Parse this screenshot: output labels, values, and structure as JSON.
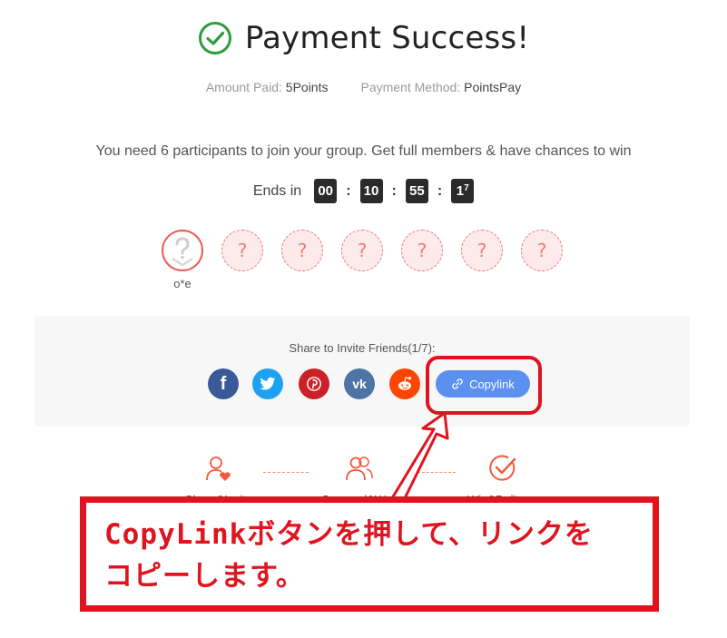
{
  "header": {
    "title": "Payment Success!",
    "icon": "check-circle-icon",
    "accent": "#2e9c3a"
  },
  "payment": {
    "amount_label": "Amount Paid:",
    "amount_value": "5Points",
    "method_label": "Payment Method:",
    "method_value": "PointsPay"
  },
  "group": {
    "message": "You need 6 participants to join your group. Get full members & have chances to win",
    "ends_label": "Ends in",
    "timer": {
      "hours": "00",
      "minutes": "10",
      "seconds": "55",
      "fraction_main": "1",
      "fraction_sup": "7"
    },
    "owner_name": "o*e",
    "empty_slot_symbol": "?"
  },
  "share": {
    "title": "Share to Invite Friends(1/7):",
    "networks": [
      "facebook-icon",
      "twitter-icon",
      "pinterest-icon",
      "vk-icon",
      "reddit-icon"
    ],
    "colors": {
      "facebook": "#3b5998",
      "twitter": "#1da1f2",
      "pinterest": "#cb2027",
      "vk": "#4c75a3",
      "reddit": "#ff4500",
      "copylink": "#5b8ff0"
    },
    "copylink_label": "Copylink"
  },
  "steps": [
    {
      "label": "Share&Invite",
      "icon": "share-invite-icon"
    },
    {
      "label": "Grouped&Wait",
      "icon": "group-wait-icon"
    },
    {
      "label": "Win&Delivery",
      "icon": "win-delivery-icon"
    }
  ],
  "annotation": {
    "line1": "CopyLinkボタンを押して、リンクを",
    "line2": "コピーします。",
    "color": "#e0141e"
  }
}
